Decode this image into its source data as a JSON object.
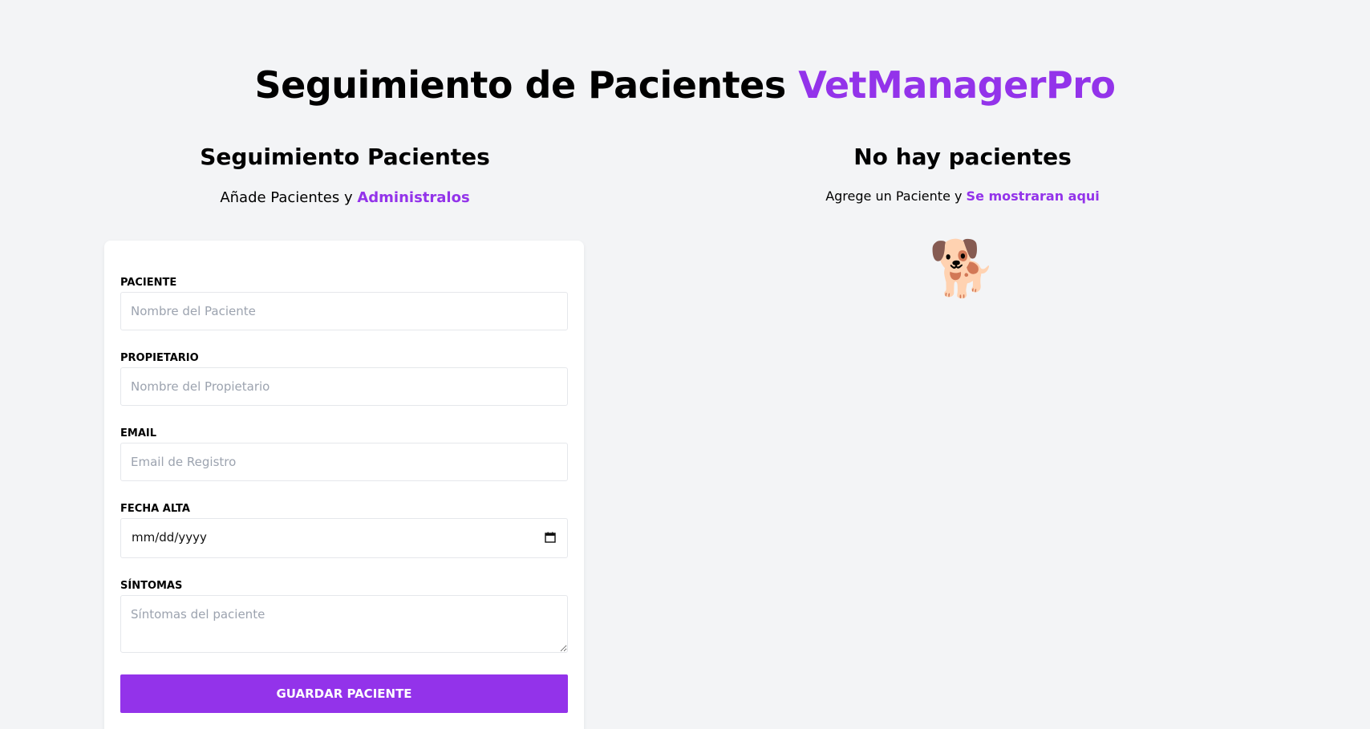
{
  "header": {
    "title_main": "Seguimiento de Pacientes ",
    "title_accent": "VetManagerPro"
  },
  "form_section": {
    "title": "Seguimiento Pacientes",
    "subtitle_text": "Añade Pacientes y ",
    "subtitle_accent": "Administralos"
  },
  "list_section": {
    "title": "No hay pacientes",
    "subtitle_text": "Agrege un Paciente y ",
    "subtitle_accent": "Se mostraran aqui",
    "empty_icon": "🐕"
  },
  "form": {
    "patient": {
      "label": "PACIENTE",
      "placeholder": "Nombre del Paciente"
    },
    "owner": {
      "label": "PROPIETARIO",
      "placeholder": "Nombre del Propietario"
    },
    "email": {
      "label": "EMAIL",
      "placeholder": "Email de Registro"
    },
    "date": {
      "label": "FECHA ALTA",
      "value": "mm/dd/yyyy"
    },
    "symptoms": {
      "label": "SÍNTOMAS",
      "placeholder": "Síntomas del paciente"
    },
    "submit_label": "GUARDAR PACIENTE"
  },
  "colors": {
    "accent": "#9333ea",
    "background": "#f3f4f6"
  }
}
